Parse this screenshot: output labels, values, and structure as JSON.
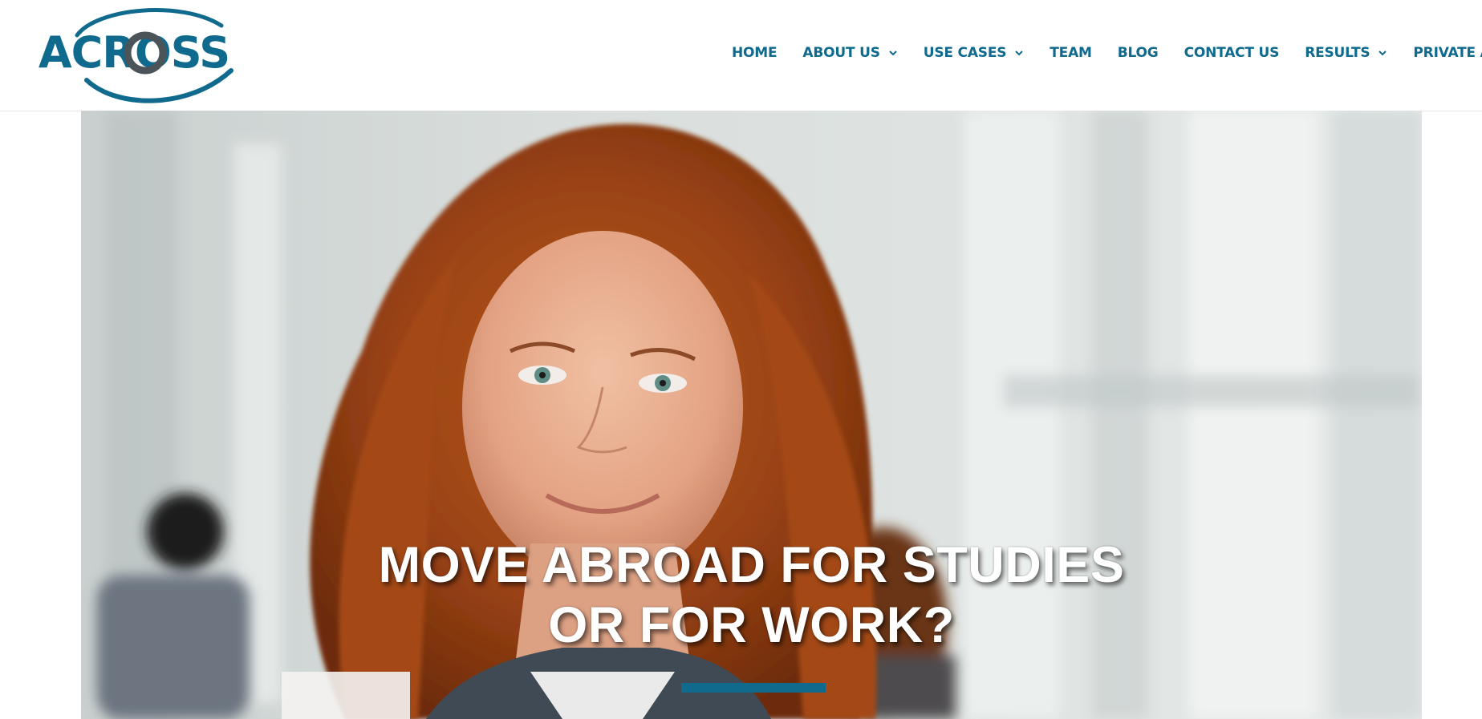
{
  "brand": {
    "name": "ACROSS",
    "accent_color": "#0f6a8e"
  },
  "nav": {
    "items": [
      {
        "label": "HOME",
        "dropdown": false
      },
      {
        "label": "ABOUT US",
        "dropdown": true
      },
      {
        "label": "USE CASES",
        "dropdown": true
      },
      {
        "label": "TEAM",
        "dropdown": false
      },
      {
        "label": "BLOG",
        "dropdown": false
      },
      {
        "label": "CONTACT US",
        "dropdown": false
      },
      {
        "label": "RESULTS",
        "dropdown": true
      },
      {
        "label": "PRIVATE AREA",
        "dropdown": false
      }
    ]
  },
  "hero": {
    "headline_line1": "MOVE ABROAD FOR STUDIES",
    "headline_line2": "OR FOR WORK?",
    "image_subject": "smiling young woman with curly red hair in a bright corridor"
  }
}
